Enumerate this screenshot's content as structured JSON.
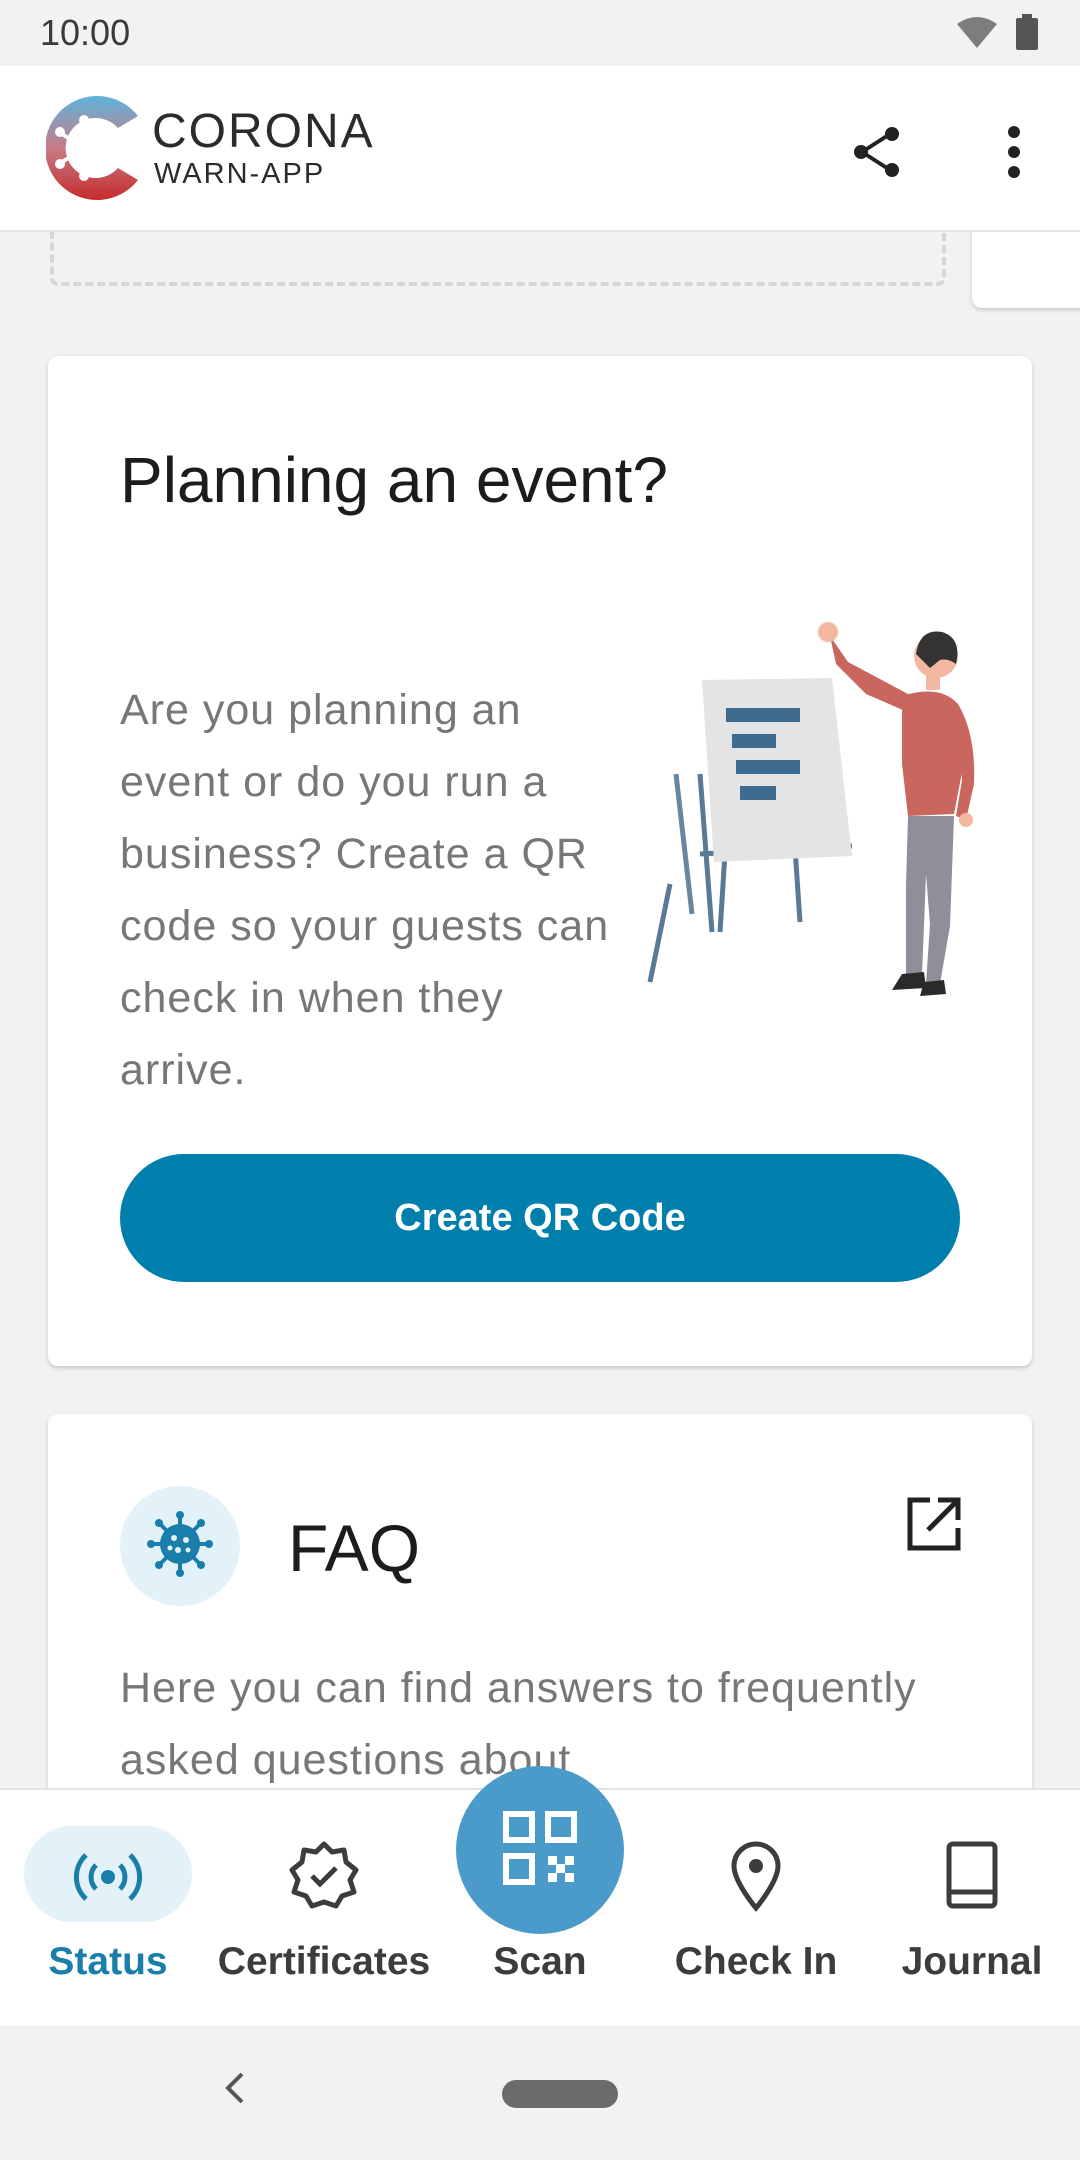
{
  "status_bar": {
    "time": "10:00"
  },
  "app_bar": {
    "logo_title": "CORONA",
    "logo_subtitle": "WARN-APP",
    "share_icon": "share-icon",
    "more_icon": "more-vert-icon"
  },
  "event_card": {
    "title": "Planning an event?",
    "text": "Are you planning an event or do you run a business? Create a QR code so your guests can check in when they arrive.",
    "button_label": "Create QR Code"
  },
  "faq_card": {
    "title": "FAQ",
    "text": "Here you can find answers to frequently asked questions about",
    "icon": "virus-icon",
    "link_icon": "open-in-new-icon"
  },
  "bottom_nav": {
    "items": [
      {
        "label": "Status",
        "icon": "broadcast-icon",
        "active": true
      },
      {
        "label": "Certificates",
        "icon": "badge-check-icon",
        "active": false
      },
      {
        "label": "Scan",
        "icon": "qr-code-icon",
        "active": false
      },
      {
        "label": "Check In",
        "icon": "location-pin-icon",
        "active": false
      },
      {
        "label": "Journal",
        "icon": "book-icon",
        "active": false
      }
    ]
  },
  "colors": {
    "primary": "#007fad",
    "active_nav": "#1a7eab",
    "active_pill": "#e3f2f9",
    "fab": "#4a9bca"
  }
}
